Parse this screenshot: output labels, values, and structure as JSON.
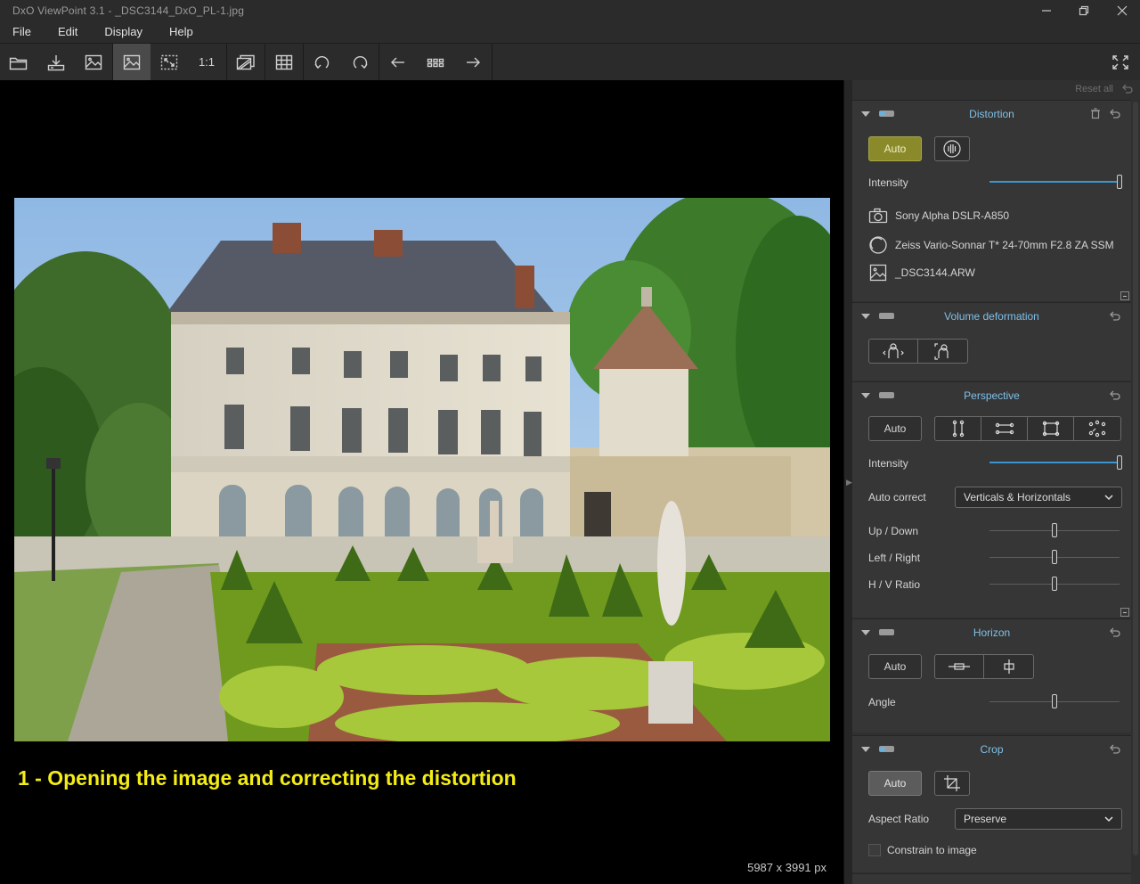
{
  "window": {
    "title": "DxO ViewPoint 3.1 - _DSC3144_DxO_PL-1.jpg",
    "controls": [
      "minimize-icon",
      "restore-icon",
      "close-icon"
    ]
  },
  "menu": [
    "File",
    "Edit",
    "Display",
    "Help"
  ],
  "toolbar": {
    "one_to_one": "1:1",
    "icons": [
      "folder-open-icon",
      "export-icon",
      "image-compare-icon",
      "image-view-icon",
      "fit-screen-icon",
      "zoom-100-icon",
      "before-after-icon",
      "grid-icon",
      "rotate-left-icon",
      "rotate-right-icon",
      "previous-icon",
      "filmstrip-icon",
      "next-icon",
      "fullscreen-icon"
    ]
  },
  "viewer": {
    "caption": "1 - Opening the image and correcting the distortion",
    "dimensions": "5987 x 3991 px"
  },
  "panel": {
    "reset_all": "Reset all",
    "distortion": {
      "title": "Distortion",
      "auto": "Auto",
      "intensity_label": "Intensity",
      "intensity": 1.0,
      "camera": "Sony Alpha DSLR-A850",
      "lens": "Zeiss Vario-Sonnar T* 24-70mm F2.8 ZA SSM",
      "file": "_DSC3144.ARW"
    },
    "volume": {
      "title": "Volume deformation"
    },
    "perspective": {
      "title": "Perspective",
      "auto": "Auto",
      "intensity_label": "Intensity",
      "intensity": 1.0,
      "auto_correct_label": "Auto correct",
      "auto_correct_value": "Verticals & Horizontals",
      "up_down_label": "Up / Down",
      "up_down": 0.5,
      "left_right_label": "Left / Right",
      "left_right": 0.5,
      "hv_ratio_label": "H / V Ratio",
      "hv_ratio": 0.5
    },
    "horizon": {
      "title": "Horizon",
      "auto": "Auto",
      "angle_label": "Angle",
      "angle": 0.5
    },
    "crop": {
      "title": "Crop",
      "auto": "Auto",
      "aspect_label": "Aspect Ratio",
      "aspect_value": "Preserve",
      "constrain_label": "Constrain to image",
      "constrain_checked": false
    }
  },
  "colors": {
    "accent_blue": "#3a95d0",
    "section_title": "#7fc0e8",
    "caption_yellow": "#f4ec16",
    "auto_active": "#8a8a2a"
  }
}
